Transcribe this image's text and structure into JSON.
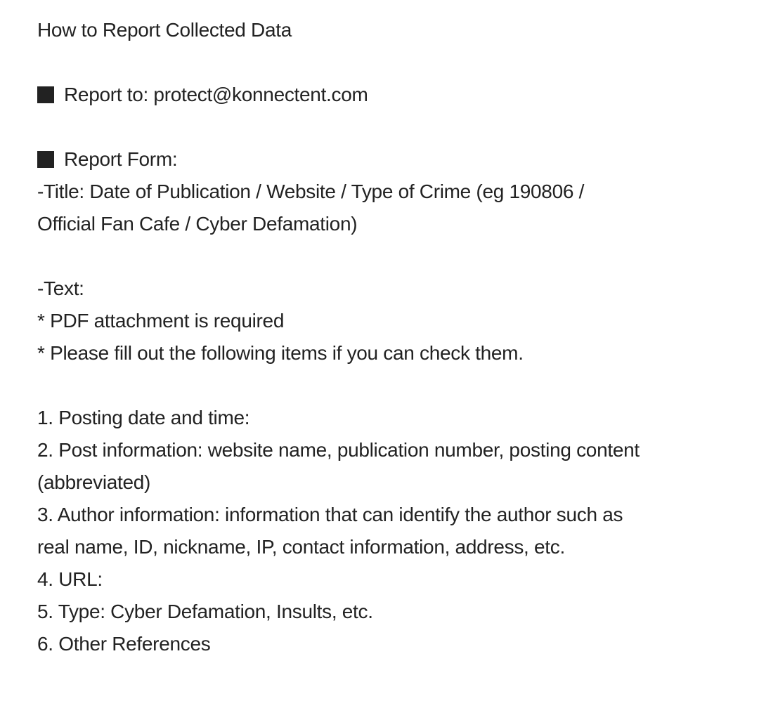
{
  "document": {
    "heading": "How to Report Collected Data",
    "report_to": {
      "icon": "black-square-icon",
      "text": "Report to: protect@konnectent.com"
    },
    "report_form": {
      "icon": "black-square-icon",
      "label": "Report Form:",
      "title_line_1": "-Title: Date of Publication / Website / Type of Crime (eg 190806 /",
      "title_line_2": "Official Fan Cafe / Cyber Defamation)"
    },
    "text_section": {
      "label": "-Text:",
      "notes": [
        "* PDF attachment is required",
        "* Please fill out the following items if you can check them."
      ]
    },
    "items": [
      {
        "lines": [
          "1. Posting date and time:"
        ]
      },
      {
        "lines": [
          "2. Post information: website name, publication number, posting content",
          "(abbreviated)"
        ]
      },
      {
        "lines": [
          "3. Author information: information that can identify the author such as",
          "real name, ID, nickname, IP, contact information, address, etc."
        ]
      },
      {
        "lines": [
          "4. URL:"
        ]
      },
      {
        "lines": [
          "5. Type: Cyber Defamation, Insults, etc."
        ]
      },
      {
        "lines": [
          "6. Other References"
        ]
      }
    ]
  }
}
